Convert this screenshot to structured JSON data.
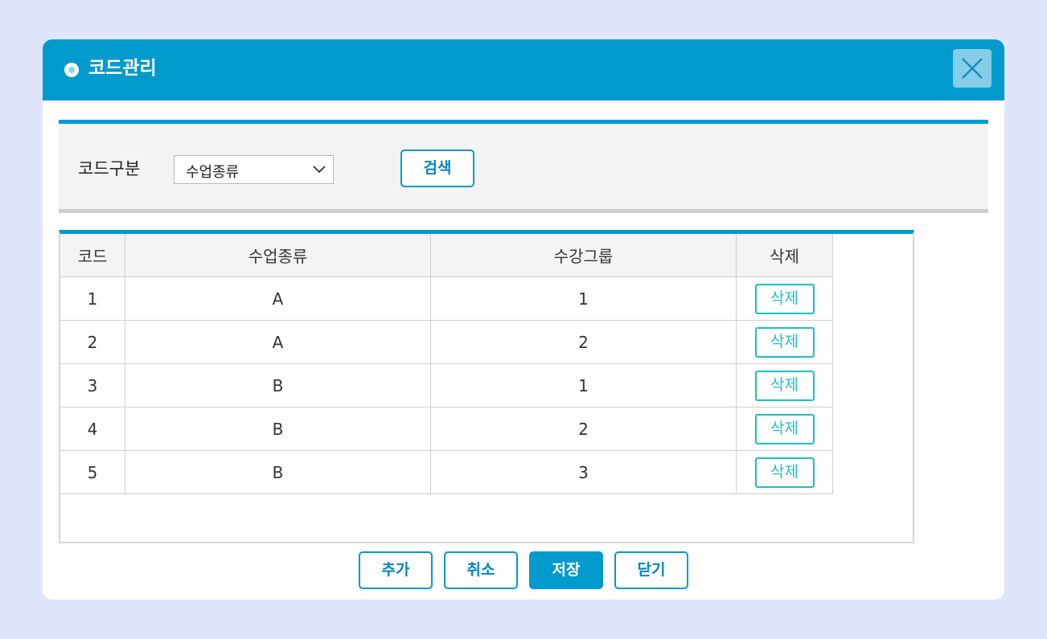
{
  "dialog": {
    "title": "코드관리",
    "close_icon": "close-icon"
  },
  "search": {
    "label": "코드구분",
    "select_value": "수업종류",
    "search_button": "검색"
  },
  "table": {
    "headers": [
      "코드",
      "수업종류",
      "수강그룹",
      "삭제"
    ],
    "rows": [
      {
        "code": "1",
        "type": "A",
        "group": "1",
        "delete": "삭제"
      },
      {
        "code": "2",
        "type": "A",
        "group": "2",
        "delete": "삭제"
      },
      {
        "code": "3",
        "type": "B",
        "group": "1",
        "delete": "삭제"
      },
      {
        "code": "4",
        "type": "B",
        "group": "2",
        "delete": "삭제"
      },
      {
        "code": "5",
        "type": "B",
        "group": "3",
        "delete": "삭제"
      }
    ]
  },
  "actions": {
    "add": "추가",
    "cancel": "취소",
    "save": "저장",
    "close": "닫기"
  },
  "colors": {
    "accent": "#009acd",
    "delete_accent": "#24bfc4",
    "background": "#dfe6fc"
  }
}
